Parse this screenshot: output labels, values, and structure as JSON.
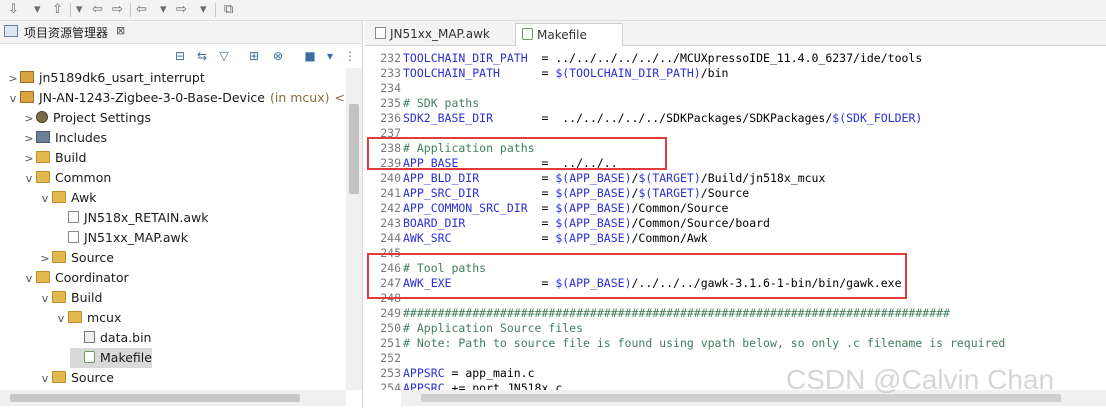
{
  "toolbar": {
    "glyphs": [
      "⇩",
      "▾",
      "⇧",
      "▾",
      "⇦",
      "⇨",
      "⇦",
      "▾",
      "⇨",
      "▾",
      "⧉"
    ]
  },
  "explorer": {
    "title": "项目资源管理器",
    "close_glyph": "⊠",
    "tools": [
      "⊟",
      "⇆",
      "▽",
      "⊞",
      "⊗",
      "■",
      "▾",
      "⋮"
    ],
    "tree": [
      {
        "label": "jn5189dk6_usart_interrupt",
        "twisty": ">",
        "icon": "project"
      },
      {
        "label": "JN-AN-1243-Zigbee-3-0-Base-Device",
        "suffix": "(in mcux)",
        "suffix2": "<End",
        "twisty": "v",
        "icon": "project"
      },
      {
        "label": "Project Settings",
        "twisty": ">",
        "icon": "gear"
      },
      {
        "label": "Includes",
        "twisty": ">",
        "icon": "lib"
      },
      {
        "label": "Build",
        "twisty": ">",
        "icon": "folder"
      },
      {
        "label": "Common",
        "twisty": "v",
        "icon": "folder"
      },
      {
        "label": "Awk",
        "twisty": "v",
        "icon": "folder"
      },
      {
        "label": "JN518x_RETAIN.awk",
        "twisty": "",
        "icon": "file"
      },
      {
        "label": "JN51xx_MAP.awk",
        "twisty": "",
        "icon": "file"
      },
      {
        "label": "Source",
        "twisty": ">",
        "icon": "folder"
      },
      {
        "label": "Coordinator",
        "twisty": "v",
        "icon": "folder"
      },
      {
        "label": "Build",
        "twisty": "v",
        "icon": "folder"
      },
      {
        "label": "mcux",
        "twisty": "v",
        "icon": "folder"
      },
      {
        "label": "data.bin",
        "twisty": "",
        "icon": "bin"
      },
      {
        "label": "Makefile",
        "twisty": "",
        "icon": "make"
      },
      {
        "label": "Source",
        "twisty": "v",
        "icon": "folder"
      }
    ]
  },
  "editor": {
    "tabs": [
      {
        "label": "JN51xx_MAP.awk"
      },
      {
        "label": "Makefile"
      }
    ],
    "lines": [
      {
        "n": "232",
        "parts": [
          [
            "v",
            "TOOLCHAIN_DIR_PATH"
          ],
          [
            "t",
            "  = ../../../../../../MCUXpressoIDE_11.4.0_6237/ide/tools"
          ]
        ]
      },
      {
        "n": "233",
        "parts": [
          [
            "v",
            "TOOLCHAIN_PATH"
          ],
          [
            "t",
            "      = "
          ],
          [
            "v",
            "$(TOOLCHAIN_DIR_PATH)"
          ],
          [
            "t",
            "/bin"
          ]
        ]
      },
      {
        "n": "234",
        "parts": []
      },
      {
        "n": "235",
        "parts": [
          [
            "c",
            "# SDK paths"
          ]
        ]
      },
      {
        "n": "236",
        "parts": [
          [
            "v",
            "SDK2_BASE_DIR"
          ],
          [
            "t",
            "       =  ../../../../../SDKPackages/SDKPackages/"
          ],
          [
            "v",
            "$(SDK_FOLDER)"
          ]
        ]
      },
      {
        "n": "237",
        "parts": []
      },
      {
        "n": "238",
        "parts": [
          [
            "c",
            "# Application paths"
          ]
        ]
      },
      {
        "n": "239",
        "parts": [
          [
            "v",
            "APP_BASE"
          ],
          [
            "t",
            "            =  ../../.."
          ]
        ]
      },
      {
        "n": "240",
        "parts": [
          [
            "v",
            "APP_BLD_DIR"
          ],
          [
            "t",
            "         = "
          ],
          [
            "v",
            "$(APP_BASE)"
          ],
          [
            "t",
            "/"
          ],
          [
            "v",
            "$(TARGET)"
          ],
          [
            "t",
            "/Build/jn518x_mcux"
          ]
        ]
      },
      {
        "n": "241",
        "parts": [
          [
            "v",
            "APP_SRC_DIR"
          ],
          [
            "t",
            "         = "
          ],
          [
            "v",
            "$(APP_BASE)"
          ],
          [
            "t",
            "/"
          ],
          [
            "v",
            "$(TARGET)"
          ],
          [
            "t",
            "/Source"
          ]
        ]
      },
      {
        "n": "242",
        "parts": [
          [
            "v",
            "APP_COMMON_SRC_DIR"
          ],
          [
            "t",
            "  = "
          ],
          [
            "v",
            "$(APP_BASE)"
          ],
          [
            "t",
            "/Common/Source"
          ]
        ]
      },
      {
        "n": "243",
        "parts": [
          [
            "v",
            "BOARD_DIR"
          ],
          [
            "t",
            "           = "
          ],
          [
            "v",
            "$(APP_BASE)"
          ],
          [
            "t",
            "/Common/Source/board"
          ]
        ]
      },
      {
        "n": "244",
        "parts": [
          [
            "v",
            "AWK_SRC"
          ],
          [
            "t",
            "             = "
          ],
          [
            "v",
            "$(APP_BASE)"
          ],
          [
            "t",
            "/Common/Awk"
          ]
        ]
      },
      {
        "n": "245",
        "parts": []
      },
      {
        "n": "246",
        "parts": [
          [
            "c",
            "# Tool paths"
          ]
        ]
      },
      {
        "n": "247",
        "parts": [
          [
            "v",
            "AWK_EXE"
          ],
          [
            "t",
            "             = "
          ],
          [
            "v",
            "$(APP_BASE)"
          ],
          [
            "t",
            "/../../../gawk-3.1.6-1-bin/bin/gawk.exe"
          ]
        ]
      },
      {
        "n": "248",
        "parts": []
      },
      {
        "n": "249",
        "parts": [
          [
            "c",
            "###############################################################################"
          ]
        ]
      },
      {
        "n": "250",
        "parts": [
          [
            "c",
            "# Application Source files"
          ]
        ]
      },
      {
        "n": "251",
        "parts": [
          [
            "c",
            "# Note: Path to source file is found using vpath below, so only .c filename is required"
          ]
        ]
      },
      {
        "n": "252",
        "parts": []
      },
      {
        "n": "253",
        "parts": [
          [
            "v",
            "APPSRC"
          ],
          [
            "t",
            " = app_main.c"
          ]
        ]
      },
      {
        "n": "254",
        "parts": [
          [
            "v",
            "APPSRC"
          ],
          [
            "t",
            " += port_JN518x.c"
          ]
        ]
      }
    ]
  },
  "watermark": "CSDN @Calvin Chan",
  "colors": {
    "highlight": "#e23b3b",
    "comment": "#3f7f5f",
    "variable": "#2a2fd6"
  }
}
